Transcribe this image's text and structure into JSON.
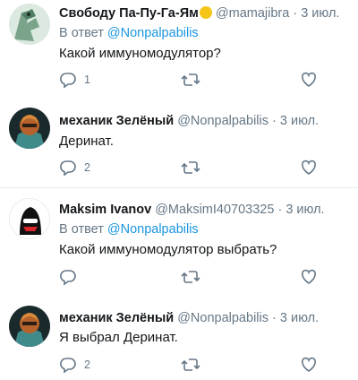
{
  "tweets": [
    {
      "name": "Свободу Па-Пу-Га-Ям",
      "handle": "@mamajibra",
      "dot": "·",
      "date": "3 июл.",
      "reply_prefix": "В ответ",
      "reply_to": "@Nonpalpabilis",
      "text": "Какой иммуномодулятор?",
      "reply_count": "1",
      "avatar": "parrot-avatar"
    },
    {
      "name": "механик Зелёный",
      "handle": "@Nonpalpabilis",
      "dot": "·",
      "date": "3 июл.",
      "text": "Деринат.",
      "reply_count": "2",
      "avatar": "mechanic-avatar"
    },
    {
      "name": "Maksim Ivanov",
      "handle": "@MaksimI40703325",
      "dot": "·",
      "date": "3 июл.",
      "reply_prefix": "В ответ",
      "reply_to": "@Nonpalpabilis",
      "text": "Какой иммуномодулятор выбрать?",
      "avatar": "default-egg-avatar"
    },
    {
      "name": "механик Зелёный",
      "handle": "@Nonpalpabilis",
      "dot": "·",
      "date": "3 июл.",
      "text": "Я выбрал Деринат.",
      "reply_count": "2",
      "avatar": "mechanic-avatar"
    }
  ],
  "colors": {
    "link": "#1b95e0",
    "secondary": "#657786",
    "text": "#14171a",
    "divider": "#e6ecf0"
  }
}
